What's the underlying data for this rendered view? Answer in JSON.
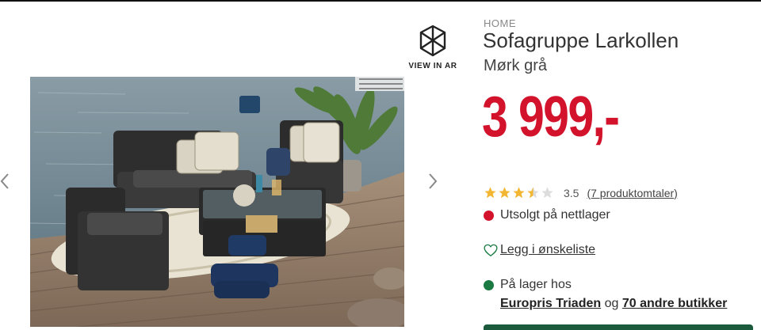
{
  "gallery": {
    "prev_icon": "chevron-left-icon",
    "next_icon": "chevron-right-icon",
    "image_alt": "Outdoor rattan sofa set on wooden dock by the water"
  },
  "ar": {
    "label": "VIEW IN AR",
    "icon": "ar-cube-icon"
  },
  "product": {
    "brand": "HOME",
    "title": "Sofagruppe Larkollen",
    "variant": "Mørk grå",
    "price": "3 999,-",
    "price_color": "#d3132c"
  },
  "rating": {
    "value": "3.5",
    "stars_filled": 3.5,
    "stars_total": 5,
    "reviews_link": "(7 produktomtaler)"
  },
  "availability": {
    "online": "Utsolgt på nettlager",
    "online_color": "#d3132c",
    "in_store_label": "På lager hos",
    "in_store_color": "#1a7a42",
    "store_name": "Europris Triaden",
    "connector": " og ",
    "other_stores": "70 andre butikker"
  },
  "wishlist": {
    "label": "Legg i ønskeliste",
    "icon": "heart-icon"
  }
}
